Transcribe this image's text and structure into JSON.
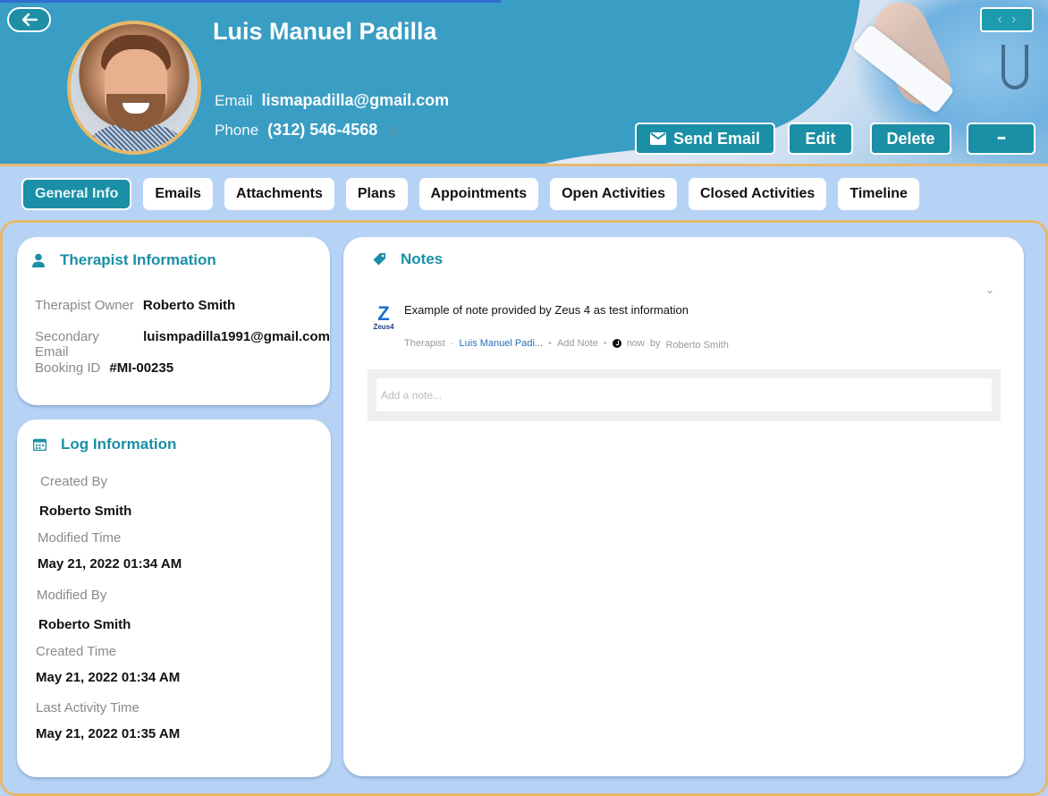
{
  "header": {
    "patient_name": "Luis Manuel Padilla",
    "email_label": "Email",
    "email_value": "lismapadilla@gmail.com",
    "phone_label": "Phone",
    "phone_value": "(312) 546-4568",
    "nav_prev": "‹",
    "nav_next": "›",
    "back_icon": "←",
    "actions": {
      "send_email": "Send Email",
      "edit": "Edit",
      "delete": "Delete",
      "more": "•••"
    }
  },
  "tabs": [
    {
      "label": "General Info",
      "active": true
    },
    {
      "label": "Emails"
    },
    {
      "label": "Attachments"
    },
    {
      "label": "Plans"
    },
    {
      "label": "Appointments"
    },
    {
      "label": "Open Activities"
    },
    {
      "label": "Closed Activities"
    },
    {
      "label": "Timeline"
    }
  ],
  "therapist_info": {
    "title": "Therapist Information",
    "fields": [
      {
        "label": "Therapist Owner",
        "value": "Roberto Smith"
      },
      {
        "label": "Secondary Email",
        "value": "luismpadilla1991@gmail.com"
      },
      {
        "label": "Booking ID",
        "value": "#MI-00235"
      }
    ]
  },
  "log_info": {
    "title": "Log Information",
    "fields": [
      {
        "label": "Created By",
        "value": "Roberto Smith"
      },
      {
        "label": "Modified Time",
        "value": "May 21, 2022 01:34 AM"
      },
      {
        "label": "Modified By",
        "value": "Roberto Smith"
      },
      {
        "label": "Created Time",
        "value": "May 21, 2022 01:34 AM"
      },
      {
        "label": "Last Activity Time",
        "value": "May 21, 2022 01:35 AM"
      }
    ]
  },
  "notes": {
    "title": "Notes",
    "items": [
      {
        "logo_text": "Zeus4",
        "text": "Example of note provided by Zeus 4 as test information",
        "module": "Therapist",
        "record_link": "Luis Manuel Padi...",
        "action": "Add Note",
        "time": "now",
        "by_label": "by",
        "author": "Roberto Smith"
      }
    ],
    "input_placeholder": "Add a note..."
  },
  "colors": {
    "header_bg": "#3a9dc3",
    "accent": "#1a8fa6",
    "page_bg": "#b6d3f6",
    "frame_border": "#e6b86a"
  }
}
